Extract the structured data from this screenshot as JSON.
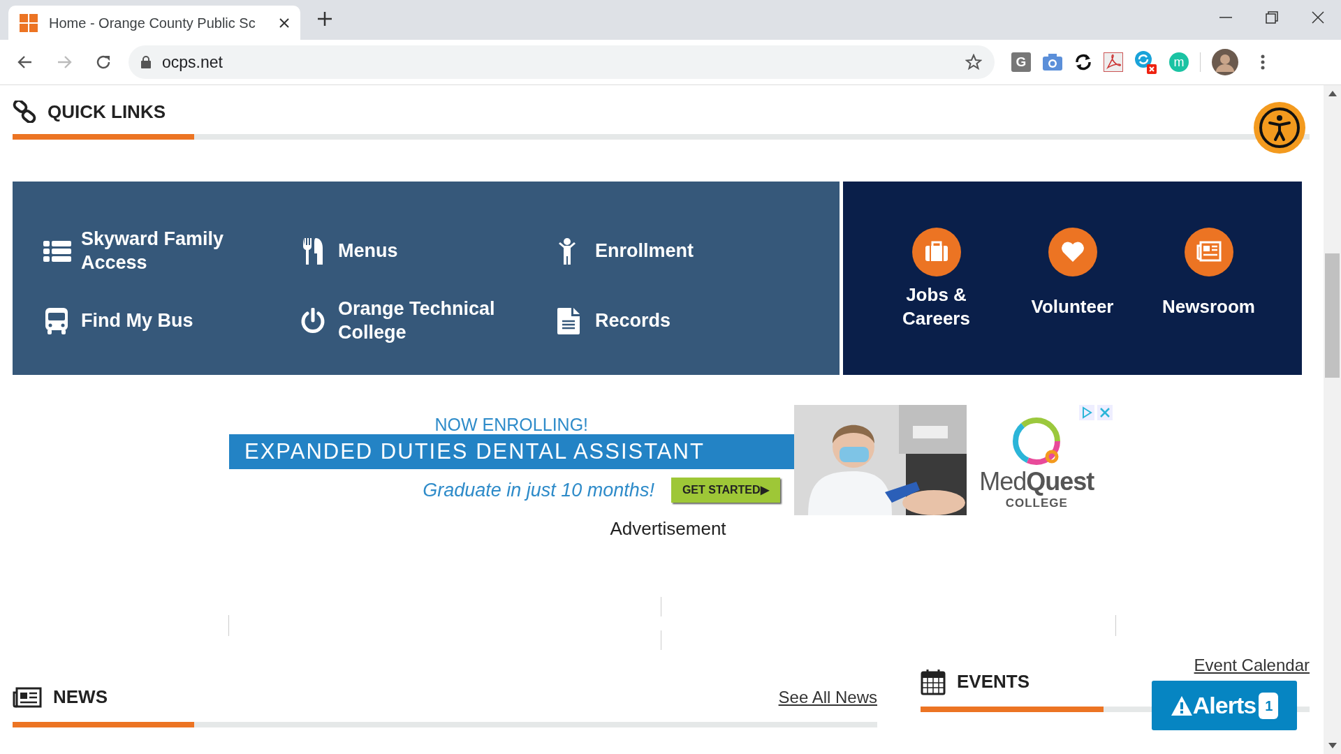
{
  "browser": {
    "tab_title": "Home - Orange County Public Sc",
    "url": "ocps.net",
    "forward_disabled": true,
    "extensions": [
      {
        "kind": "letter",
        "label": "G"
      },
      {
        "kind": "camera"
      },
      {
        "kind": "sync"
      },
      {
        "kind": "pdf"
      },
      {
        "kind": "blocked"
      },
      {
        "kind": "round-letter",
        "label": "m"
      }
    ]
  },
  "quick_links": {
    "title": "QUICK LINKS",
    "level": 0.14,
    "items": [
      {
        "label": "Skyward Family Access"
      },
      {
        "label": "Menus"
      },
      {
        "label": "Enrollment"
      },
      {
        "label": "Find My Bus"
      },
      {
        "label": "Orange Technical College"
      },
      {
        "label": "Records"
      }
    ],
    "featured": [
      {
        "label": "Jobs & Careers"
      },
      {
        "label": "Volunteer"
      },
      {
        "label": "Newsroom"
      }
    ]
  },
  "advertisement": {
    "headline": "NOW ENROLLING!",
    "banner": "EXPANDED DUTIES DENTAL ASSISTANT",
    "tagline": "Graduate in just 10 months!",
    "button": "GET STARTED▶",
    "brand_light": "Med",
    "brand_bold": "Quest",
    "brand_sub": "COLLEGE",
    "caption": "Advertisement"
  },
  "news": {
    "title": "NEWS",
    "link": "See All News",
    "level": 0.21
  },
  "events": {
    "title": "EVENTS",
    "link": "Event Calendar",
    "level": 0.47
  },
  "alerts": {
    "label": "Alerts",
    "count": "1"
  }
}
